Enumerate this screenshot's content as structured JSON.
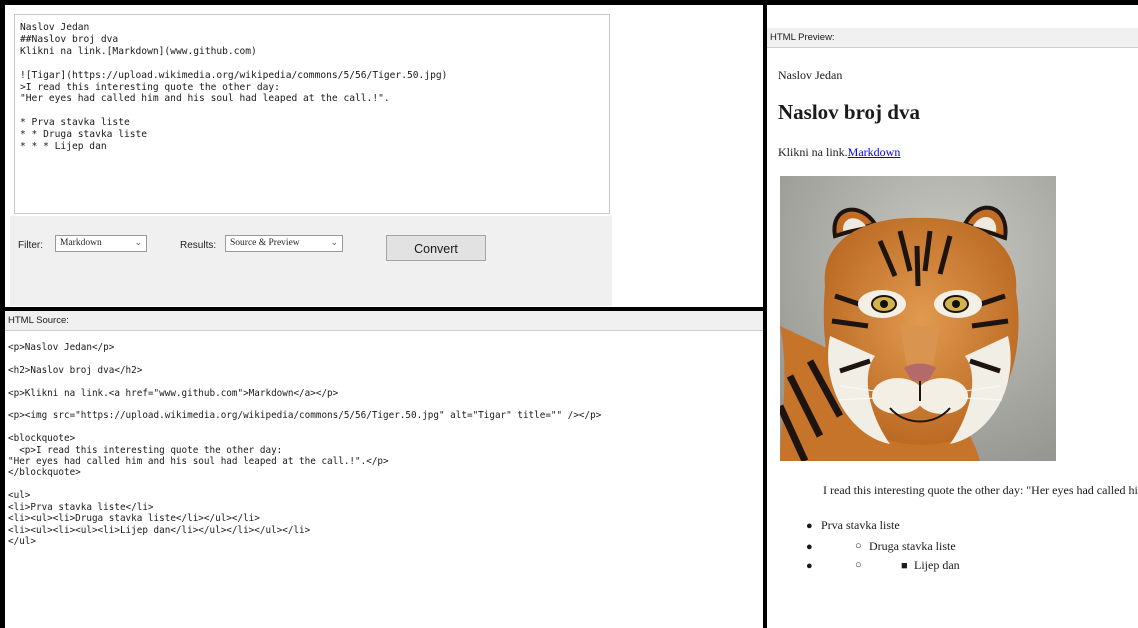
{
  "editor": {
    "text": "Naslov Jedan\n##Naslov broj dva\nKlikni na link.[Markdown](www.github.com)\n\n![Tigar](https://upload.wikimedia.org/wikipedia/commons/5/56/Tiger.50.jpg)\n>I read this interesting quote the other day:\n\"Her eyes had called him and his soul had leaped at the call.!\".\n\n* Prva stavka liste\n* * Druga stavka liste\n* * * Lijep dan"
  },
  "controls": {
    "filter_label": "Filter:",
    "filter_value": "Markdown",
    "results_label": "Results:",
    "results_value": "Source & Preview",
    "convert_label": "Convert"
  },
  "source": {
    "header": "HTML Source:",
    "text": "<p>Naslov Jedan</p>\n\n<h2>Naslov broj dva</h2>\n\n<p>Klikni na link.<a href=\"www.github.com\">Markdown</a></p>\n\n<p><img src=\"https://upload.wikimedia.org/wikipedia/commons/5/56/Tiger.50.jpg\" alt=\"Tigar\" title=\"\" /></p>\n\n<blockquote>\n  <p>I read this interesting quote the other day:\n\"Her eyes had called him and his soul had leaped at the call.!\".</p>\n</blockquote>\n\n<ul>\n<li>Prva stavka liste</li>\n<li><ul><li>Druga stavka liste</li></ul></li>\n<li><ul><li><ul><li>Lijep dan</li></ul></li></ul></li>\n</ul>"
  },
  "preview": {
    "header": "HTML Preview:",
    "p1": "Naslov Jedan",
    "h2": "Naslov broj dva",
    "link_prefix": "Klikni na link.",
    "link_text": "Markdown",
    "quote": "I read this interesting quote the other day: \"Her eyes had called him and his soul had leaped at the call.!\".",
    "list": [
      "Prva stavka liste",
      "Druga stavka liste",
      "Lijep dan"
    ]
  },
  "colors": {
    "link": "#0000ee",
    "divider": "#000000",
    "panel_bg": "#f0f0f0"
  }
}
